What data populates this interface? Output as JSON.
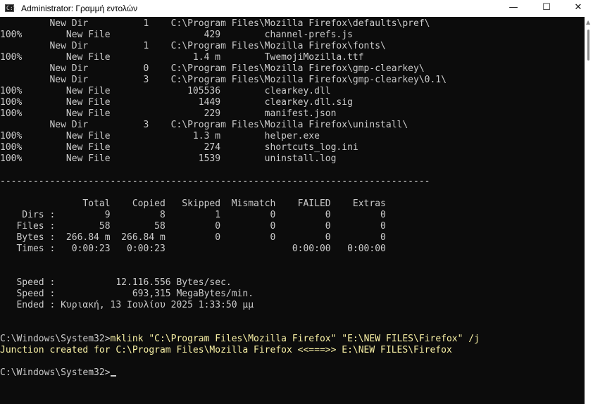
{
  "window": {
    "title": "Administrator: Γραμμή εντολών",
    "icon_glyph": "C:\\",
    "minimize_glyph": "—",
    "maximize_glyph": "☐",
    "close_glyph": "✕"
  },
  "console": {
    "lines": [
      "         New Dir          1    C:\\Program Files\\Mozilla Firefox\\defaults\\pref\\",
      "100%        New File                 429        channel-prefs.js",
      "         New Dir          1    C:\\Program Files\\Mozilla Firefox\\fonts\\",
      "100%        New File               1.4 m        TwemojiMozilla.ttf",
      "         New Dir          0    C:\\Program Files\\Mozilla Firefox\\gmp-clearkey\\",
      "         New Dir          3    C:\\Program Files\\Mozilla Firefox\\gmp-clearkey\\0.1\\",
      "100%        New File              105536        clearkey.dll",
      "100%        New File                1449        clearkey.dll.sig",
      "100%        New File                 229        manifest.json",
      "         New Dir          3    C:\\Program Files\\Mozilla Firefox\\uninstall\\",
      "100%        New File               1.3 m        helper.exe",
      "100%        New File                 274        shortcuts_log.ini",
      "100%        New File                1539        uninstall.log",
      "",
      "------------------------------------------------------------------------------",
      "",
      "               Total    Copied   Skipped  Mismatch    FAILED    Extras",
      "    Dirs :         9         8         1         0         0         0",
      "   Files :        58        58         0         0         0         0",
      "   Bytes :  266.84 m  266.84 m         0         0         0         0",
      "   Times :   0:00:23   0:00:23                       0:00:00   0:00:00",
      "",
      "",
      "   Speed :           12.116.556 Bytes/sec.",
      "   Speed :              693,315 MegaBytes/min.",
      "   Ended : Κυριακή, 13 Ιουλίου 2025 1:33:50 μμ",
      "",
      ""
    ],
    "command_prompt": "C:\\Windows\\System32>",
    "command_text": "mklink \"C:\\Program Files\\Mozilla Firefox\" \"E:\\NEW FILES\\Firefox\" /j",
    "output_line": "Junction created for C:\\Program Files\\Mozilla Firefox <<===>> E:\\NEW FILES\\Firefox",
    "current_prompt": "C:\\Windows\\System32>"
  },
  "scrollbar": {
    "up_glyph": "▲"
  }
}
